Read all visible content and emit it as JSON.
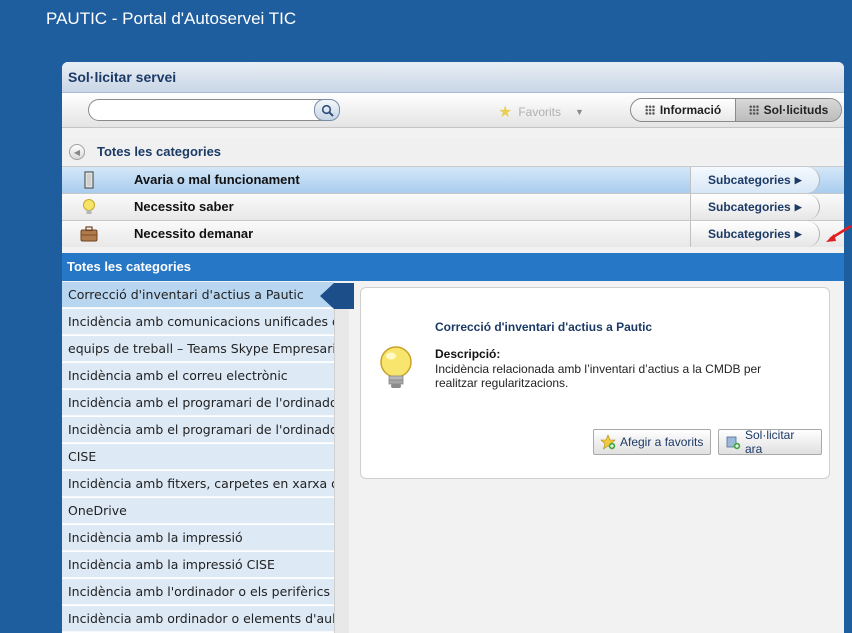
{
  "portal": {
    "title": "PAUTIC - Portal d'Autoservei TIC"
  },
  "panel": {
    "title": "Sol·licitar servei"
  },
  "toolbar": {
    "search_value": "",
    "favorites_label": "Favorits",
    "info_label": "Informació",
    "requests_label": "Sol·licituds"
  },
  "breadcrumb": {
    "all_categories": "Totes les categories"
  },
  "categories": [
    {
      "label": "Avaria o mal funcionament",
      "sub": "Subcategories",
      "icon": "door-icon"
    },
    {
      "label": "Necessito saber",
      "sub": "Subcategories",
      "icon": "lightbulb-icon"
    },
    {
      "label": "Necessito demanar",
      "sub": "Subcategories",
      "icon": "briefcase-icon"
    }
  ],
  "list": {
    "header": "Totes les categories",
    "items": [
      "Correcció d'inventari d'actius a Pautic",
      "Incidència amb comunicacions unificades o",
      "equips de treball – Teams Skype Empresarial",
      "Incidència amb el correu electrònic",
      "Incidència amb el programari de l'ordinador",
      "Incidència amb el programari de l'ordinador",
      "CISE",
      "Incidència amb fitxers, carpetes en xarxa o",
      "OneDrive",
      "Incidència amb la impressió",
      "Incidència amb la impressió CISE",
      "Incidència amb l'ordinador o els perifèrics",
      "Incidència amb ordinador o elements d'aula"
    ]
  },
  "detail": {
    "title": "Correcció d'inventari d'actius a Pautic",
    "desc_label": "Descripció:",
    "desc_text": "Incidència relacionada amb l’inventari d’actius a la CMDB per realitzar regularitzacions.",
    "add_fav": "Afegir a favorits",
    "request_now": "Sol·licitar ara"
  },
  "colors": {
    "page_bg": "#1f5e9e",
    "accent": "#2677c6",
    "selected_row": "#a9ccee",
    "arrow": "#e02020"
  }
}
